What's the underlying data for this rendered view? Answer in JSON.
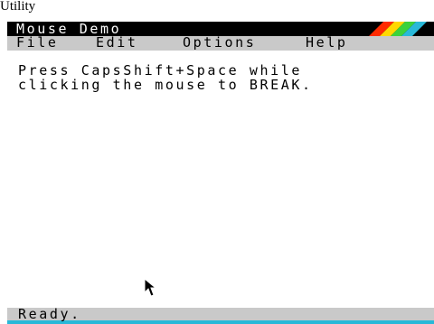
{
  "caption": "Utility",
  "window": {
    "title": "Mouse Demo"
  },
  "menu": {
    "items": [
      {
        "label": "File"
      },
      {
        "label": "Edit"
      },
      {
        "label": "Options"
      },
      {
        "label": "Help"
      }
    ]
  },
  "content": {
    "lines": [
      "Press CapsShift+Space while",
      "clicking the mouse to BREAK."
    ]
  },
  "status": {
    "text": "Ready."
  },
  "colors": {
    "titlebar": "#000000",
    "menubar": "#c9c9c9",
    "status_accent": "#29b8d8",
    "stripes": [
      "#ff2a00",
      "#ffd800",
      "#3bd23b",
      "#29b8d8"
    ]
  },
  "icons": {
    "cursor": "arrow-pointer-icon",
    "logo": "rainbow-stripes-logo"
  }
}
